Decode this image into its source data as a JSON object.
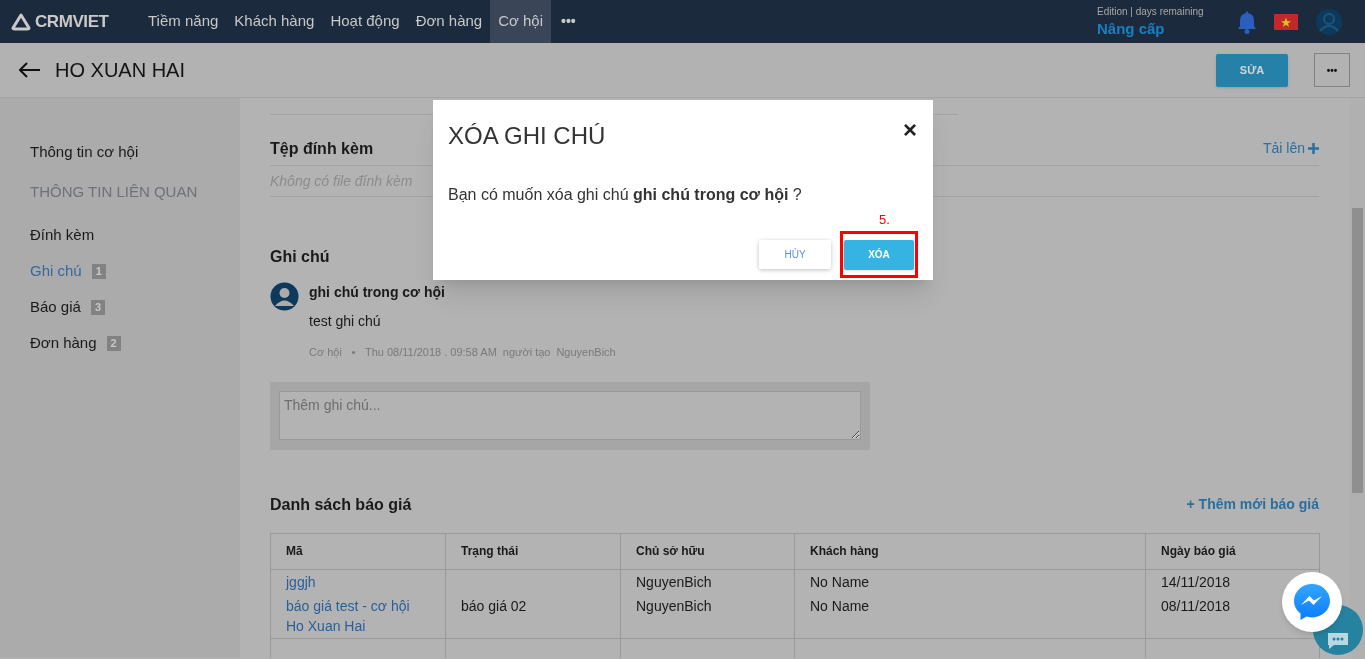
{
  "nav": {
    "logo": "CRMVIET",
    "items": [
      {
        "label": "Tiềm năng",
        "selected": false
      },
      {
        "label": "Khách hàng",
        "selected": false
      },
      {
        "label": "Hoạt động",
        "selected": false
      },
      {
        "label": "Đơn hàng",
        "selected": false
      },
      {
        "label": "Cơ hội",
        "selected": true
      }
    ],
    "more": "•••",
    "edition": "Edition | days remaining",
    "upgrade": "Nâng cấp"
  },
  "header": {
    "title": "HO XUAN HAI",
    "edit_button": "SỬA",
    "more_button": "•••"
  },
  "sidebar": {
    "items": [
      {
        "label": "Thông tin cơ hội",
        "kind": "item",
        "selected": false
      },
      {
        "label": "THÔNG TIN LIÊN QUAN",
        "kind": "heading"
      },
      {
        "label": "Đính kèm",
        "kind": "item",
        "selected": false
      },
      {
        "label": "Ghi chú",
        "kind": "item",
        "selected": true,
        "badge": "1"
      },
      {
        "label": "Báo giá",
        "kind": "item",
        "selected": false,
        "badge": "3"
      },
      {
        "label": "Đơn hàng",
        "kind": "item",
        "selected": false,
        "badge": "2"
      }
    ]
  },
  "attachments": {
    "title": "Tệp đính kèm",
    "upload": "Tải lên",
    "empty": "Không có file đính kèm"
  },
  "notes": {
    "title": "Ghi chú",
    "items": [
      {
        "title": "ghi chú trong cơ hội",
        "body": "test ghi chú",
        "source": "Cơ hội",
        "time": "Thu 08/11/2018 . 09:58 AM",
        "author_label": "người tạo",
        "author": "NguyenBich"
      }
    ],
    "placeholder": "Thêm ghi chú..."
  },
  "quotes": {
    "title": "Danh sách báo giá",
    "add": "+ Thêm mới báo giá",
    "columns": [
      "Mã",
      "Trạng thái",
      "Chủ sở hữu",
      "Khách hàng",
      "Ngày báo giá"
    ],
    "rows": [
      [
        "jggjh",
        "",
        "NguyenBich",
        "No Name",
        "14/11/2018"
      ],
      [
        "báo giá test - cơ hội Ho Xuan Hai",
        "báo giá 02",
        "NguyenBich",
        "No Name",
        "08/11/2018"
      ]
    ]
  },
  "dialog": {
    "title": "XÓA GHI CHÚ",
    "close": "×",
    "message": "Bạn có muốn xóa ghi chú **ghi chú trong cơ hội** ?",
    "cancel": "HỦY",
    "confirm": "XÓA",
    "annotation": "5."
  }
}
